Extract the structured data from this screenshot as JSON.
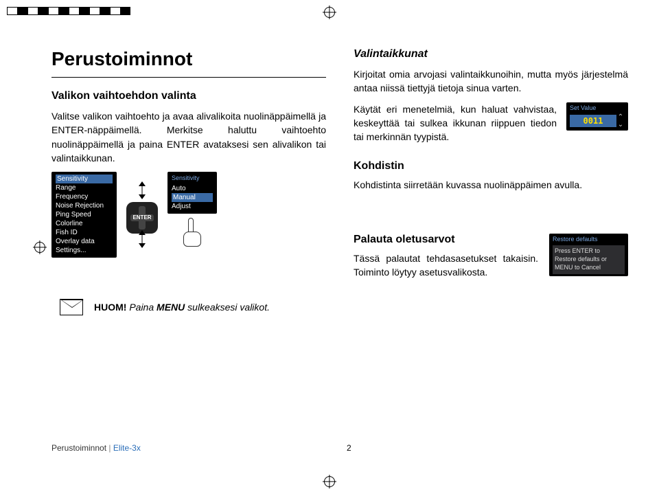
{
  "top_bar_colors": [
    "#fff",
    "#000",
    "#fff",
    "#000",
    "#fff",
    "#000",
    "#fff"
  ],
  "h1": "Perustoiminnot",
  "left": {
    "sub1": "Valikon vaihtoehdon valinta",
    "p1": "Valitse valikon vaihtoehto ja avaa alivalikoita nuolinäppäimellä ja ENTER-näppäimellä. Merkitse haluttu vaihtoehto nuolinäppäimellä ja paina ENTER avataksesi sen alivalikon tai valintaikkunan.",
    "menu1": {
      "items": [
        "Sensitivity",
        "Range",
        "Frequency",
        "Noise Rejection",
        "Ping Speed",
        "Colorline",
        "Fish ID",
        "Overlay data",
        "Settings..."
      ],
      "highlight_index": 0
    },
    "dpad_label": "ENTER",
    "menu2": {
      "title": "Sensitivity",
      "items": [
        "Auto",
        "Manual",
        "Adjust"
      ],
      "highlight_index": 1
    }
  },
  "note": {
    "bold": "HUOM!",
    "italic_prefix": " Paina ",
    "menu_word": "MENU",
    "italic_suffix": " sulkeaksesi valikot."
  },
  "right": {
    "sub1": "Valintaikkunat",
    "p1": "Kirjoitat omia arvojasi valintaikkunoihin, mutta myös järjestelmä antaa niissä tiettyjä tietoja sinua varten.",
    "p2": "Käytät eri menetelmiä, kun haluat vahvistaa, keskeyttää tai sulkea ikkunan riippuen tiedon tai merkinnän tyypistä.",
    "set_value": {
      "title": "Set Value",
      "value": "0011"
    },
    "sub2": "Kohdistin",
    "p3": "Kohdistinta siirretään kuvassa nuolinäppäimen avulla.",
    "sub3": "Palauta oletusarvot",
    "p4": "Tässä palautat tehdasasetukset takaisin. Toiminto löytyy asetusvalikosta.",
    "restore": {
      "title": "Restore defaults",
      "body": "Press ENTER to Restore defaults or MENU to Cancel"
    }
  },
  "footer": {
    "section": "Perustoiminnot",
    "brand": "Elite-3x",
    "page": "2"
  }
}
